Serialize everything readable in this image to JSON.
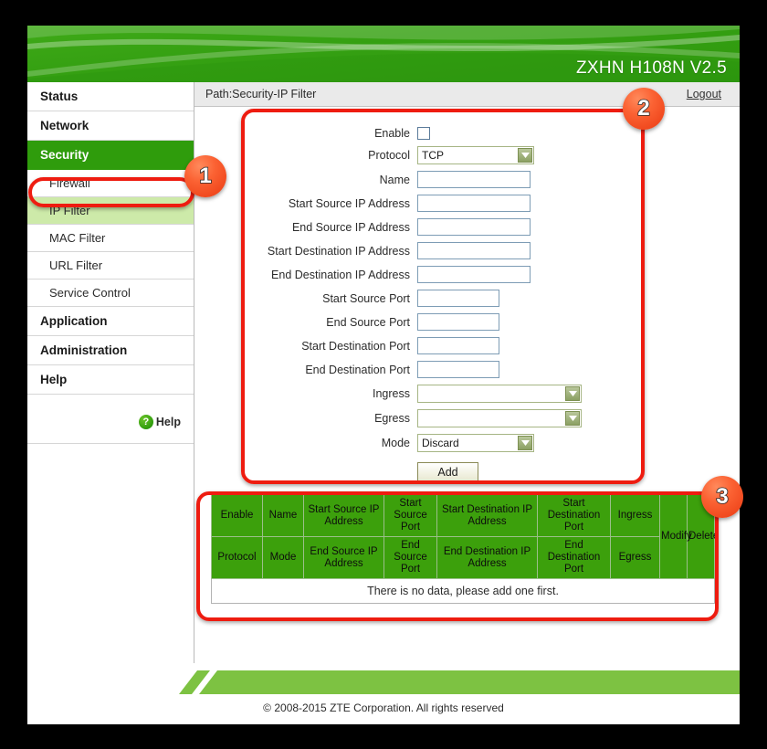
{
  "header": {
    "model": "ZXHN H108N V2.5"
  },
  "pathbar": {
    "path": "Path:Security-IP Filter",
    "logout": "Logout"
  },
  "sidebar": {
    "items": [
      {
        "label": "Status",
        "level": "top",
        "state": "normal"
      },
      {
        "label": "Network",
        "level": "top",
        "state": "normal"
      },
      {
        "label": "Security",
        "level": "top",
        "state": "active"
      },
      {
        "label": "Firewall",
        "level": "sub",
        "state": "normal"
      },
      {
        "label": "IP Filter",
        "level": "sub",
        "state": "selected"
      },
      {
        "label": "MAC Filter",
        "level": "sub",
        "state": "normal"
      },
      {
        "label": "URL Filter",
        "level": "sub",
        "state": "normal"
      },
      {
        "label": "Service Control",
        "level": "sub",
        "state": "normal"
      },
      {
        "label": "Application",
        "level": "top",
        "state": "normal"
      },
      {
        "label": "Administration",
        "level": "top",
        "state": "normal"
      },
      {
        "label": "Help",
        "level": "top",
        "state": "normal"
      }
    ],
    "help": {
      "glyph": "?",
      "label": "Help"
    }
  },
  "form": {
    "fields": [
      {
        "label": "Enable",
        "type": "checkbox",
        "value": "",
        "checked": false
      },
      {
        "label": "Protocol",
        "type": "select",
        "value": "TCP"
      },
      {
        "label": "Name",
        "type": "text",
        "value": "",
        "placeholder": ""
      },
      {
        "label": "Start Source IP Address",
        "type": "text",
        "value": "",
        "placeholder": ""
      },
      {
        "label": "End Source IP Address",
        "type": "text",
        "value": "",
        "placeholder": ""
      },
      {
        "label": "Start Destination IP Address",
        "type": "text",
        "value": "",
        "placeholder": ""
      },
      {
        "label": "End Destination IP Address",
        "type": "text",
        "value": "",
        "placeholder": ""
      },
      {
        "label": "Start Source Port",
        "type": "text",
        "value": "",
        "placeholder": ""
      },
      {
        "label": "End Source Port",
        "type": "text",
        "value": "",
        "placeholder": ""
      },
      {
        "label": "Start Destination Port",
        "type": "text",
        "value": "",
        "placeholder": ""
      },
      {
        "label": "End Destination Port",
        "type": "text",
        "value": "",
        "placeholder": ""
      },
      {
        "label": "Ingress",
        "type": "select",
        "value": ""
      },
      {
        "label": "Egress",
        "type": "select",
        "value": ""
      },
      {
        "label": "Mode",
        "type": "select",
        "value": "Discard"
      }
    ],
    "add_button": "Add"
  },
  "table": {
    "header_row_1": [
      "Enable",
      "Name",
      "Start Source IP Address",
      "Start Source Port",
      "Start Destination IP Address",
      "Start Destination Port",
      "Ingress"
    ],
    "header_row_2": [
      "Protocol",
      "Mode",
      "End Source IP Address",
      "End Source Port",
      "End Destination IP Address",
      "End Destination Port",
      "Egress"
    ],
    "header_span": [
      "Modify",
      "Delete"
    ],
    "empty_message": "There is no data, please add one first.",
    "rows": []
  },
  "footer": {
    "copyright": "© 2008-2015 ZTE Corporation. All rights reserved"
  },
  "annotations": {
    "badges": [
      {
        "number": "1",
        "target": "ip-filter-menu-item"
      },
      {
        "number": "2",
        "target": "ip-filter-form"
      },
      {
        "number": "3",
        "target": "ip-filter-rules-table"
      }
    ]
  },
  "colors": {
    "brand_green": "#2f9c0c",
    "banner_green": "#35a012",
    "table_header_green": "#3ca00c",
    "selected_row_green": "#cdeaa9",
    "annotation_red": "#ee1c10",
    "badge_orange": "#fb6233",
    "input_border": "#7d9cb5",
    "select_border": "#a6b584"
  }
}
